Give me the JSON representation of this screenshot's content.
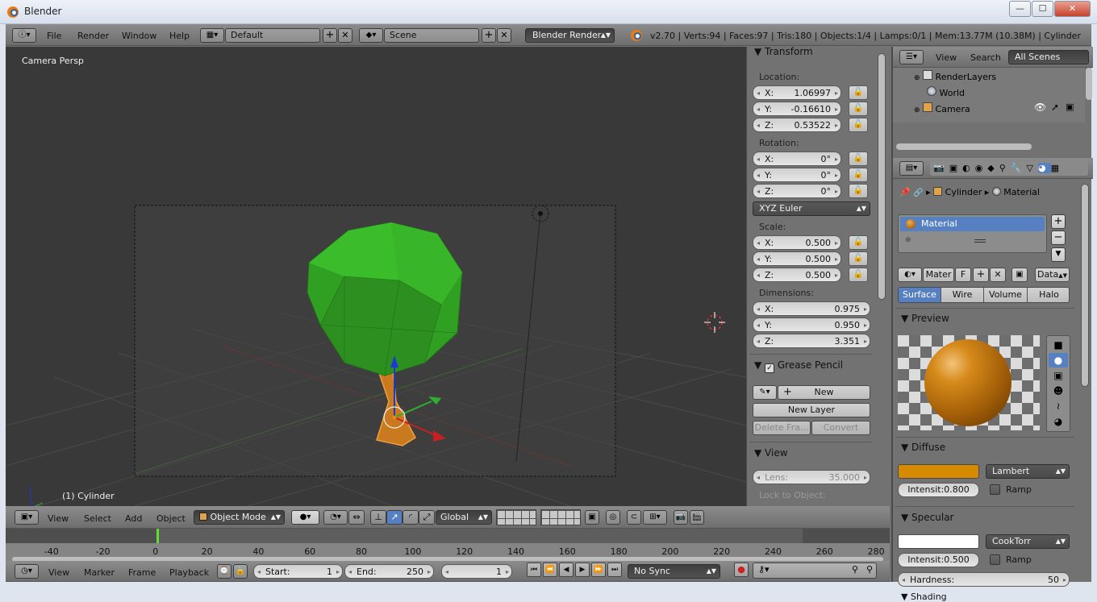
{
  "window": {
    "title": "Blender",
    "minimize": "—",
    "maximize": "☐",
    "close": "✕"
  },
  "info_header": {
    "menus": [
      "File",
      "Render",
      "Window",
      "Help"
    ],
    "screen_layout": "Default",
    "scene": "Scene",
    "engine": "Blender Render",
    "stats": "v2.70 | Verts:94 | Faces:97 | Tris:180 | Objects:1/4 | Lamps:0/1 | Mem:13.77M (10.38M) | Cylinder"
  },
  "viewport": {
    "view_label": "Camera Persp",
    "object_label": "(1) Cylinder"
  },
  "transform": {
    "title": "Transform",
    "location_label": "Location:",
    "location": [
      {
        "axis": "X:",
        "value": "1.06997"
      },
      {
        "axis": "Y:",
        "value": "-0.16610"
      },
      {
        "axis": "Z:",
        "value": "0.53522"
      }
    ],
    "rotation_label": "Rotation:",
    "rotation": [
      {
        "axis": "X:",
        "value": "0°"
      },
      {
        "axis": "Y:",
        "value": "0°"
      },
      {
        "axis": "Z:",
        "value": "0°"
      }
    ],
    "rotation_mode": "XYZ Euler",
    "scale_label": "Scale:",
    "scale": [
      {
        "axis": "X:",
        "value": "0.500"
      },
      {
        "axis": "Y:",
        "value": "0.500"
      },
      {
        "axis": "Z:",
        "value": "0.500"
      }
    ],
    "dimensions_label": "Dimensions:",
    "dimensions": [
      {
        "axis": "X:",
        "value": "0.975"
      },
      {
        "axis": "Y:",
        "value": "0.950"
      },
      {
        "axis": "Z:",
        "value": "3.351"
      }
    ]
  },
  "grease_pencil": {
    "title": "Grease Pencil",
    "new": "New",
    "new_layer": "New Layer",
    "delete_frame": "Delete Fra...",
    "convert": "Convert"
  },
  "view_panel": {
    "title": "View",
    "lens_label": "Lens:",
    "lens_value": "35.000",
    "lock_label": "Lock to Object:"
  },
  "outliner": {
    "menus": [
      "View",
      "Search"
    ],
    "filter": "All Scenes",
    "items": [
      "RenderLayers",
      "World",
      "Camera"
    ]
  },
  "properties": {
    "breadcrumb": [
      "Cylinder",
      "Material"
    ],
    "slot": "Material",
    "material_name": "Mater",
    "fake_user": "F",
    "link": "Data",
    "tabs": [
      "Surface",
      "Wire",
      "Volume",
      "Halo"
    ],
    "preview_title": "Preview",
    "diffuse": {
      "title": "Diffuse",
      "color": "#d68a00",
      "shader": "Lambert",
      "intensity": "Intensit:0.800",
      "ramp": "Ramp"
    },
    "specular": {
      "title": "Specular",
      "color": "#ffffff",
      "shader": "CookTorr",
      "intensity": "Intensit:0.500",
      "ramp": "Ramp",
      "hardness_label": "Hardness:",
      "hardness_value": "50"
    },
    "shading_title": "Shading"
  },
  "view3d_header": {
    "menus": [
      "View",
      "Select",
      "Add",
      "Object"
    ],
    "mode": "Object Mode",
    "orientation": "Global"
  },
  "timeline": {
    "ticks": [
      "-40",
      "-20",
      "0",
      "20",
      "40",
      "60",
      "80",
      "100",
      "120",
      "140",
      "160",
      "180",
      "200",
      "220",
      "240",
      "260",
      "280"
    ],
    "menus": [
      "View",
      "Marker",
      "Frame",
      "Playback"
    ],
    "start_label": "Start:",
    "start": "1",
    "end_label": "End:",
    "end": "250",
    "current": "1",
    "sync": "No Sync"
  },
  "colors": {
    "accent": "#5680c2",
    "selected": "#e88a1a",
    "tree_green": "#3aa02a",
    "trunk": "#c87a1e"
  }
}
